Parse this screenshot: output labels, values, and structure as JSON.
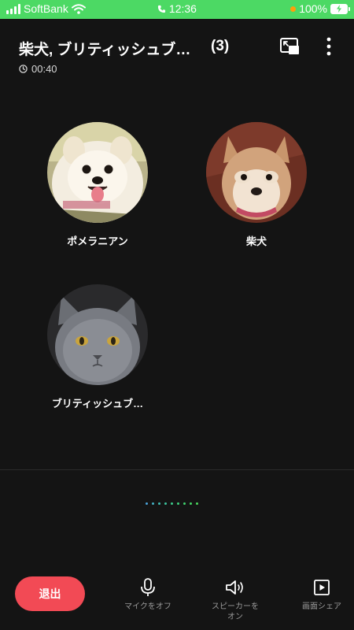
{
  "status_bar": {
    "carrier": "SoftBank",
    "time": "12:36",
    "battery": "100%"
  },
  "header": {
    "title": "柴犬, ブリティッシュブ…",
    "count": "(3)",
    "timer": "00:40"
  },
  "participants": [
    {
      "name": "ポメラニアン"
    },
    {
      "name": "柴犬"
    },
    {
      "name": "ブリティッシュブ…"
    }
  ],
  "footer": {
    "leave_label": "退出",
    "mic_label": "マイクをオフ",
    "speaker_label_1": "スピーカーを",
    "speaker_label_2": "オン",
    "share_label": "画面シェア"
  },
  "colors": {
    "status_bar": "#4cd964",
    "background": "#141414",
    "leave": "#f24a55"
  },
  "icons": [
    "wifi-icon",
    "phone-icon",
    "clock-icon",
    "pip-icon",
    "more-icon",
    "mic-icon",
    "speaker-icon",
    "screen-share-icon"
  ]
}
